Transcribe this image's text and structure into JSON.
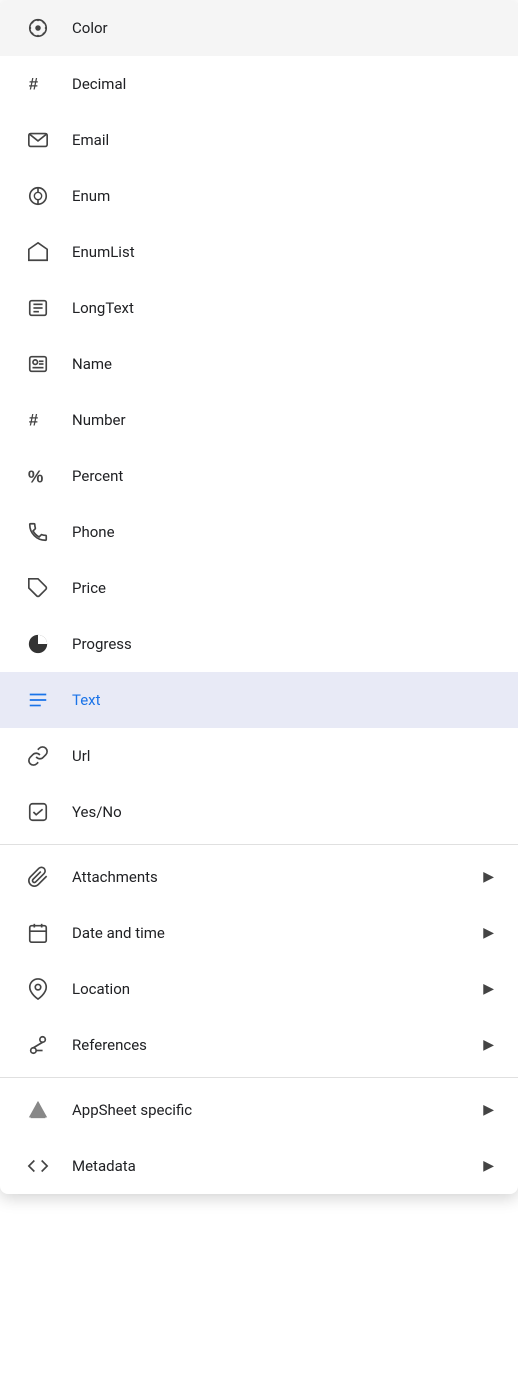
{
  "menu": {
    "items": [
      {
        "id": "color",
        "label": "Color",
        "icon": "color",
        "selected": false,
        "hasArrow": false
      },
      {
        "id": "decimal",
        "label": "Decimal",
        "icon": "decimal",
        "selected": false,
        "hasArrow": false
      },
      {
        "id": "email",
        "label": "Email",
        "icon": "email",
        "selected": false,
        "hasArrow": false
      },
      {
        "id": "enum",
        "label": "Enum",
        "icon": "enum",
        "selected": false,
        "hasArrow": false
      },
      {
        "id": "enumlist",
        "label": "EnumList",
        "icon": "enumlist",
        "selected": false,
        "hasArrow": false
      },
      {
        "id": "longtext",
        "label": "LongText",
        "icon": "longtext",
        "selected": false,
        "hasArrow": false
      },
      {
        "id": "name",
        "label": "Name",
        "icon": "name",
        "selected": false,
        "hasArrow": false
      },
      {
        "id": "number",
        "label": "Number",
        "icon": "number",
        "selected": false,
        "hasArrow": false
      },
      {
        "id": "percent",
        "label": "Percent",
        "icon": "percent",
        "selected": false,
        "hasArrow": false
      },
      {
        "id": "phone",
        "label": "Phone",
        "icon": "phone",
        "selected": false,
        "hasArrow": false
      },
      {
        "id": "price",
        "label": "Price",
        "icon": "price",
        "selected": false,
        "hasArrow": false
      },
      {
        "id": "progress",
        "label": "Progress",
        "icon": "progress",
        "selected": false,
        "hasArrow": false
      },
      {
        "id": "text",
        "label": "Text",
        "icon": "text",
        "selected": true,
        "hasArrow": false
      },
      {
        "id": "url",
        "label": "Url",
        "icon": "url",
        "selected": false,
        "hasArrow": false
      },
      {
        "id": "yesno",
        "label": "Yes/No",
        "icon": "yesno",
        "selected": false,
        "hasArrow": false
      }
    ],
    "grouped_items": [
      {
        "id": "attachments",
        "label": "Attachments",
        "icon": "attachments",
        "hasArrow": true
      },
      {
        "id": "datetime",
        "label": "Date and time",
        "icon": "datetime",
        "hasArrow": true
      },
      {
        "id": "location",
        "label": "Location",
        "icon": "location",
        "hasArrow": true
      },
      {
        "id": "references",
        "label": "References",
        "icon": "references",
        "hasArrow": true
      }
    ],
    "appsheet_items": [
      {
        "id": "appsheet",
        "label": "AppSheet specific",
        "icon": "appsheet",
        "hasArrow": true
      },
      {
        "id": "metadata",
        "label": "Metadata",
        "icon": "metadata",
        "hasArrow": true
      }
    ]
  }
}
